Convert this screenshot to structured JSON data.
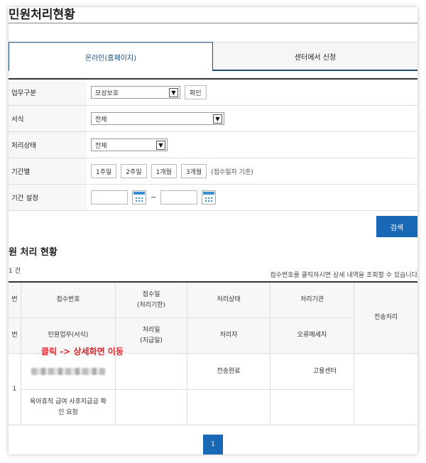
{
  "page": {
    "title": "민원처리현황"
  },
  "tabs": [
    {
      "label": "온라인(홈페이지)",
      "active": true
    },
    {
      "label": "센터에서 신청",
      "active": false
    }
  ],
  "form": {
    "work_type": {
      "label": "업무구분",
      "value": "모성보호",
      "confirm_label": "확인"
    },
    "form_type": {
      "label": "서식",
      "value": "전체"
    },
    "status": {
      "label": "처리상태",
      "value": "전체"
    },
    "period": {
      "label": "기간별",
      "options": [
        "1주일",
        "2주일",
        "1개월",
        "3개월"
      ],
      "hint": "(접수일자 기준)"
    },
    "period_setting": {
      "label": "기간 설정",
      "tilde": "~"
    }
  },
  "search_label": "검색",
  "results": {
    "section_title": "원 처리 현황",
    "count_text": "1 건",
    "notice": "접수번호를 클릭하시면 상세 내역을 조회할 수 있습니다",
    "headers": {
      "col0_top": "번",
      "col0_bottom": "번",
      "receipt_no": "접수번호",
      "receipt_date": "접수일\n(처리기한)",
      "status": "처리상태",
      "agency": "처리기관",
      "transfer": "전송처리",
      "civil_work": "민원업무(서식)",
      "process_date": "처리일\n(지급일)",
      "processor": "처리자",
      "error_msg": "오류메세지"
    },
    "rows": [
      {
        "index": "1",
        "status": "전송완료",
        "agency": "고용센터",
        "civil_work": "육아휴직 급여 사후지급금 확인 요청"
      }
    ],
    "overlay_note": "클릭 -> 상세화면 이동"
  },
  "pagination": {
    "current": "1"
  },
  "colors": {
    "primary": "#1968b5",
    "tab_border": "#1f4e7a",
    "annotation": "#e0262b"
  }
}
